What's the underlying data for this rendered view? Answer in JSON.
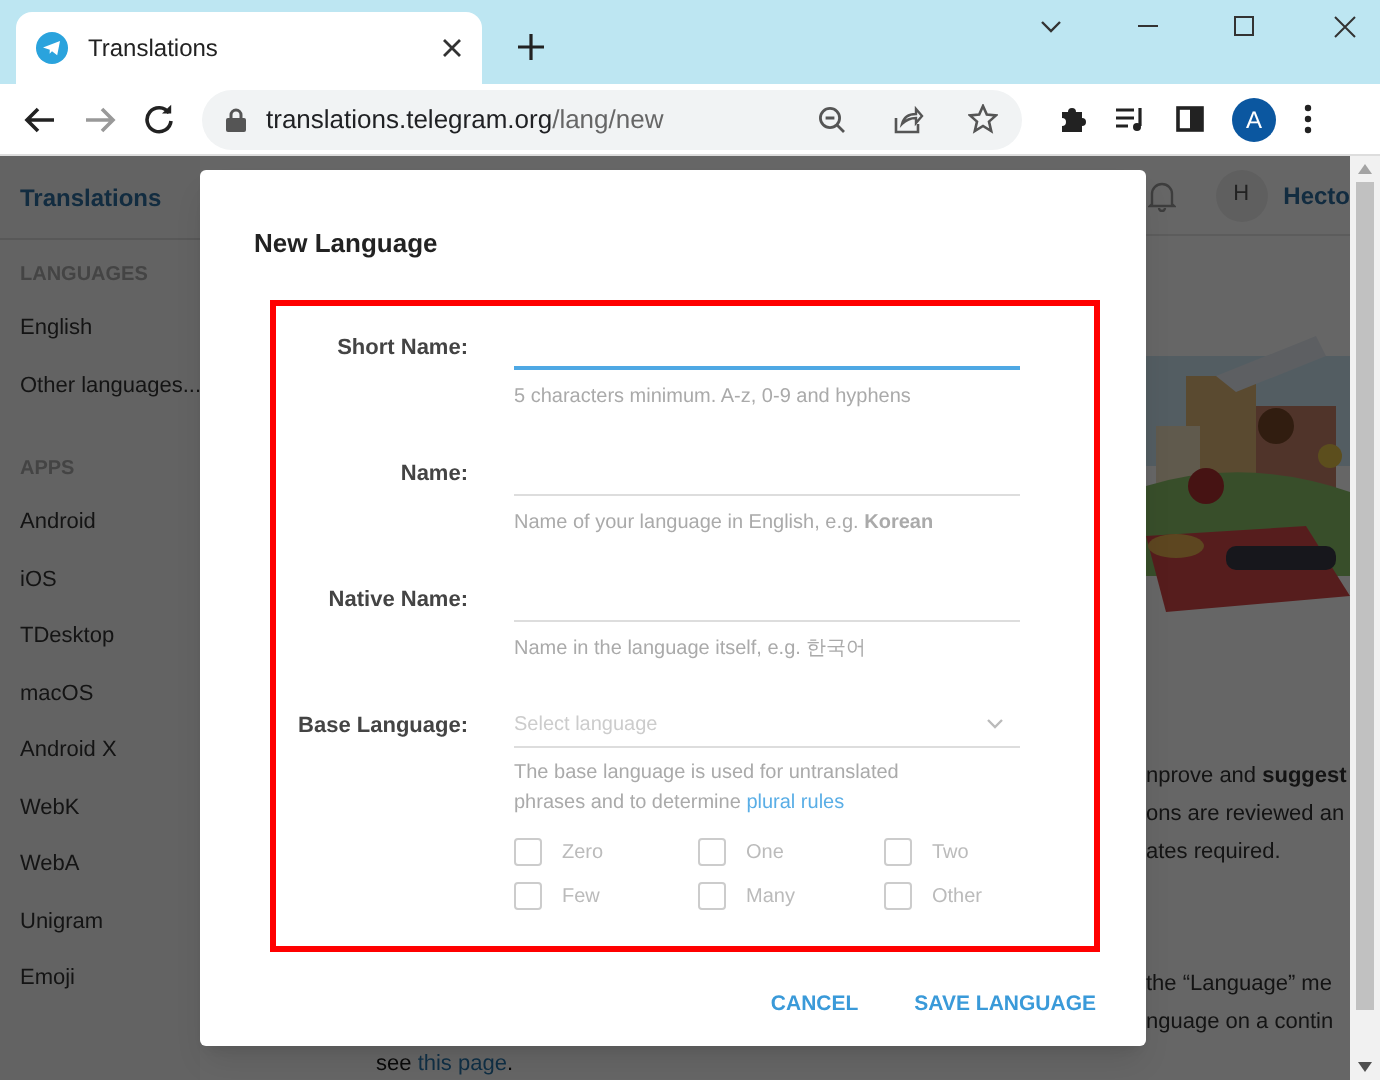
{
  "browser": {
    "tab": {
      "title": "Translations"
    },
    "url": {
      "host": "translations.telegram.org",
      "path": "/lang/new"
    },
    "profile_initial": "A"
  },
  "page": {
    "header": {
      "brand": "Translations",
      "avatar_initial": "H",
      "user_name": "Hecto"
    },
    "sidebar": [
      {
        "heading": "LANGUAGES",
        "items": [
          "English",
          "Other languages..."
        ]
      },
      {
        "heading": "APPS",
        "items": [
          "Android",
          "iOS",
          "TDesktop",
          "macOS",
          "Android X",
          "WebK",
          "WebA",
          "Unigram",
          "Emoji"
        ]
      }
    ],
    "content_paragraphs": [
      {
        "lines": [
          "nprove and **suggest**",
          "ons are reviewed an",
          "ates required."
        ]
      },
      {
        "lines": [
          "the “Language” me",
          "nguage on a contin"
        ]
      }
    ],
    "footer": {
      "prefix": "see",
      "link": "this page",
      "suffix": "."
    }
  },
  "dialog": {
    "title": "New Language",
    "fields": [
      {
        "kind": "text",
        "label": "Short Name:",
        "focused": true,
        "hint": "5 characters minimum. A-z, 0-9 and hyphens"
      },
      {
        "kind": "text",
        "label": "Name:",
        "focused": false,
        "hint": "Name of your language in English, e.g. **Korean**"
      },
      {
        "kind": "text",
        "label": "Native Name:",
        "focused": false,
        "hint": "Name in the language itself, e.g. 한국어"
      },
      {
        "kind": "select",
        "label": "Base Language:",
        "placeholder": "Select language",
        "hint": "The base language is used for untranslated phrases and to determine",
        "hint_link": "plural rules"
      }
    ],
    "plural_forms": [
      {
        "label": "Zero",
        "checked": false
      },
      {
        "label": "One",
        "checked": false
      },
      {
        "label": "Two",
        "checked": false
      },
      {
        "label": "Few",
        "checked": false
      },
      {
        "label": "Many",
        "checked": false
      },
      {
        "label": "Other",
        "checked": false
      }
    ],
    "buttons": [
      {
        "label": "CANCEL"
      },
      {
        "label": "SAVE LANGUAGE"
      }
    ]
  }
}
